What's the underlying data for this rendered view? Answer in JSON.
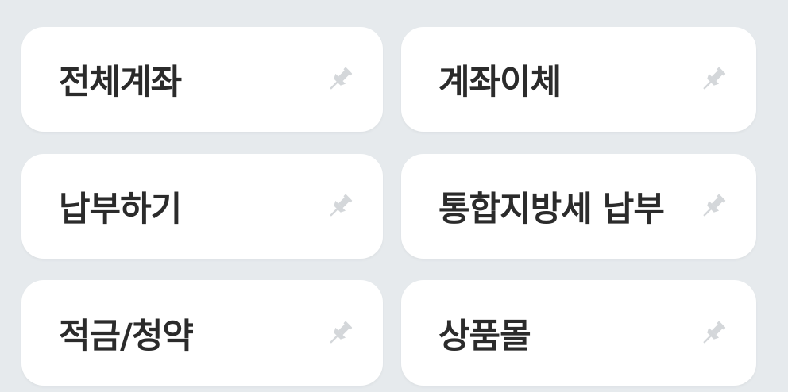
{
  "tiles": [
    {
      "label": "전체계좌",
      "icon": "pin-icon"
    },
    {
      "label": "계좌이체",
      "icon": "pin-icon"
    },
    {
      "label": "납부하기",
      "icon": "pin-icon"
    },
    {
      "label": "통합지방세 납부",
      "icon": "pin-icon"
    },
    {
      "label": "적금/청약",
      "icon": "pin-icon"
    },
    {
      "label": "상품몰",
      "icon": "pin-icon"
    }
  ],
  "colors": {
    "background": "#e6eaed",
    "tile": "#ffffff",
    "text": "#2b2b2b",
    "pin": "#d4d7da"
  }
}
